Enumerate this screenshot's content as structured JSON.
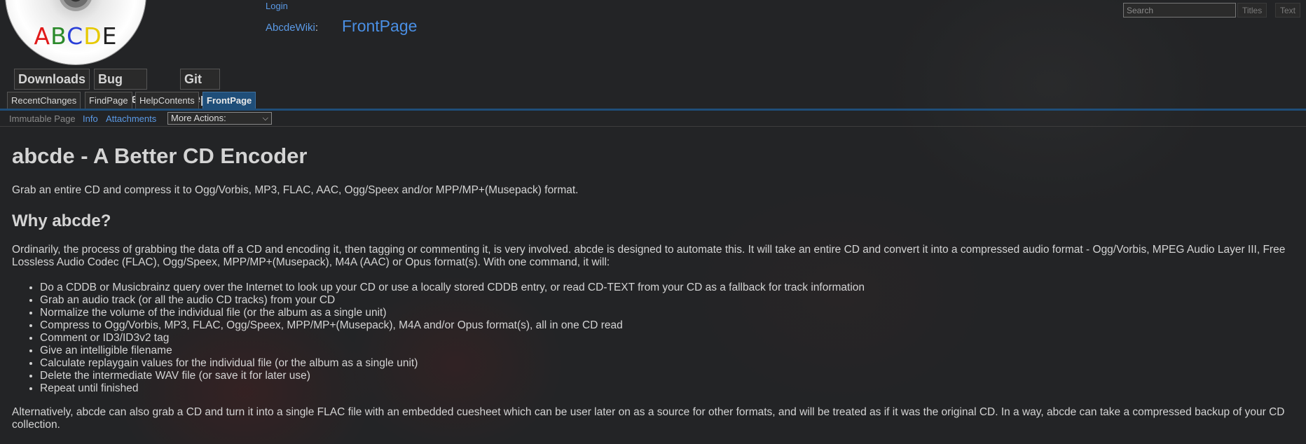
{
  "header": {
    "logo_text": [
      "A",
      "B",
      "C",
      "D",
      "E"
    ],
    "logo_colors": [
      "#e01b1b",
      "#2b8a2b",
      "#2a3fd8",
      "#e6c900",
      "#222222"
    ],
    "login": "Login",
    "wiki_name": "AbcdeWiki",
    "wiki_colon": ":",
    "page_name": "FrontPage",
    "search_placeholder": "Search",
    "titles_button": "Titles",
    "text_button": "Text"
  },
  "navibar": [
    "Downloads",
    "Bug Tracker",
    "Git Repo"
  ],
  "tabs": [
    "RecentChanges",
    "FindPage",
    "HelpContents",
    "FrontPage"
  ],
  "actions": {
    "immutable": "Immutable Page",
    "info": "Info",
    "attachments": "Attachments",
    "more_actions": "More Actions:"
  },
  "content": {
    "title": "abcde - A Better CD Encoder",
    "intro": "Grab an entire CD and compress it to Ogg/Vorbis, MP3, FLAC, AAC, Ogg/Speex and/or MPP/MP+(Musepack) format.",
    "why_heading": "Why abcde?",
    "ordinarily": "Ordinarily, the process of grabbing the data off a CD and encoding it, then tagging or commenting it, is very involved. abcde is designed to automate this. It will take an entire CD and convert it into a compressed audio format - Ogg/Vorbis, MPEG Audio Layer III, Free Lossless Audio Codec (FLAC), Ogg/Speex, MPP/MP+(Musepack), M4A (AAC) or Opus format(s). With one command, it will:",
    "features": [
      "Do a CDDB or Musicbrainz query over the Internet to look up your CD or use a locally stored CDDB entry, or read CD-TEXT from your CD as a fallback for track information",
      "Grab an audio track (or all the audio CD tracks) from your CD",
      "Normalize the volume of the individual file (or the album as a single unit)",
      "Compress to Ogg/Vorbis, MP3, FLAC, Ogg/Speex, MPP/MP+(Musepack), M4A and/or Opus format(s), all in one CD read",
      "Comment or ID3/ID3v2 tag",
      "Give an intelligible filename",
      "Calculate replaygain values for the individual file (or the album as a single unit)",
      "Delete the intermediate WAV file (or save it for later use)",
      "Repeat until finished"
    ],
    "alternatively": "Alternatively, abcde can also grab a CD and turn it into a single FLAC file with an embedded cuesheet which can be user later on as a source for other formats, and will be treated as if it was the original CD. In a way, abcde can take a compressed backup of your CD collection."
  }
}
